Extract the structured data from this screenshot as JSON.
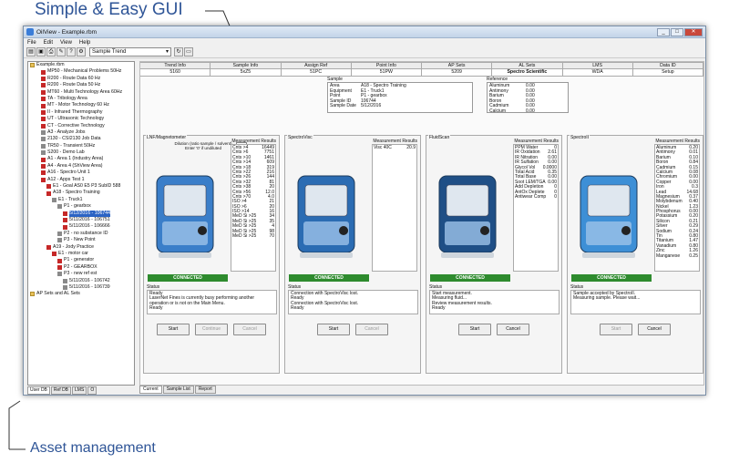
{
  "annotations": {
    "top": "Simple & Easy GUI",
    "bottom": "Asset management"
  },
  "window": {
    "title": "OilView - Example.rbm"
  },
  "menu": [
    "File",
    "Edit",
    "View",
    "Help"
  ],
  "toolbar": {
    "dropdown_value": "Sample Trend"
  },
  "tree": [
    {
      "label": "Example.rbm",
      "indent": 0,
      "mk": "folder"
    },
    {
      "label": "MP50 - Mechanical Problems  50Hz",
      "indent": 2,
      "mk": "red"
    },
    {
      "label": "R200 - Route Data  60 Hz",
      "indent": 2,
      "mk": "red"
    },
    {
      "label": "R200 - Route Data  50 Hz",
      "indent": 2,
      "mk": "red"
    },
    {
      "label": "MT60 - Multi Technology Area  60Hz",
      "indent": 2,
      "mk": "red"
    },
    {
      "label": "TA - Tribology Area",
      "indent": 2,
      "mk": "red"
    },
    {
      "label": "MT - Motor Technology 60 Hz",
      "indent": 2,
      "mk": "red"
    },
    {
      "label": "II - Infrared Thermography",
      "indent": 2,
      "mk": "red"
    },
    {
      "label": "UT - Ultrasonic Technology",
      "indent": 2,
      "mk": "red"
    },
    {
      "label": "CT - Corrective Technology",
      "indent": 2,
      "mk": "red"
    },
    {
      "label": "A3 - Analyze Jobs",
      "indent": 2,
      "mk": "gray"
    },
    {
      "label": "2130 - CSI2130 Job Data",
      "indent": 2,
      "mk": "gray"
    },
    {
      "label": "TR50 - Transient  50Hz",
      "indent": 2,
      "mk": "gray"
    },
    {
      "label": "S200 - Demo Lab",
      "indent": 2,
      "mk": "gray"
    },
    {
      "label": "A1 - Area 1 (Industry Area)",
      "indent": 2,
      "mk": "red"
    },
    {
      "label": "A4 - Area 4 (ShView Area)",
      "indent": 2,
      "mk": "red"
    },
    {
      "label": "A16 - Spectro Unit 1",
      "indent": 2,
      "mk": "red"
    },
    {
      "label": "A12 - Apps Test 1",
      "indent": 2,
      "mk": "red"
    },
    {
      "label": "E1 - Goal AS0 E5 P3 SubID 588",
      "indent": 3,
      "mk": "red"
    },
    {
      "label": "A18 - Spectro Training",
      "indent": 3,
      "mk": "red"
    },
    {
      "label": "E1 - Truck1",
      "indent": 4,
      "mk": "gray"
    },
    {
      "label": "P1 - gearbox",
      "indent": 5,
      "mk": "gray"
    },
    {
      "label": "5/12/2016 - 106744",
      "indent": 6,
      "mk": "red",
      "sel": true
    },
    {
      "label": "5/11/2016 - 106751",
      "indent": 6,
      "mk": "red"
    },
    {
      "label": "5/11/2016 - 106666",
      "indent": 6,
      "mk": "red"
    },
    {
      "label": "P2 - no substance ID",
      "indent": 5,
      "mk": "gray"
    },
    {
      "label": "P3 - New Point",
      "indent": 5,
      "mk": "gray"
    },
    {
      "label": "A19 - Jody Practice",
      "indent": 3,
      "mk": "red"
    },
    {
      "label": "E1 - motor car",
      "indent": 4,
      "mk": "red"
    },
    {
      "label": "P1 - generator",
      "indent": 5,
      "mk": "red"
    },
    {
      "label": "P2 - GEARBOX",
      "indent": 5,
      "mk": "red"
    },
    {
      "label": "P3 - new ref est",
      "indent": 5,
      "mk": "gray"
    },
    {
      "label": "5/11/2016 - 106742",
      "indent": 6,
      "mk": "gray"
    },
    {
      "label": "5/11/2016 - 106739",
      "indent": 6,
      "mk": "gray"
    },
    {
      "label": "AP Sets and AL Sets",
      "indent": 0,
      "mk": "folder"
    }
  ],
  "left_tabs": [
    "User DB",
    "Ref DB",
    "LMS",
    "O"
  ],
  "info_headers": [
    "Trend Info",
    "Sample Info",
    "Assign Ref",
    "Point Info",
    "AP Sets",
    "AL Sets",
    "LMS",
    "Data ID"
  ],
  "info_values": [
    "5160",
    "5xZ5",
    "51PC",
    "51PW",
    "5209",
    "Spectro Scientific",
    "WDA",
    "Setup"
  ],
  "sample": {
    "caption": "Sample",
    "fields": [
      {
        "k": "Area",
        "v": "A18 - Spectro Training"
      },
      {
        "k": "Equipment",
        "v": "E1 - Truck1"
      },
      {
        "k": "Point",
        "v": "P1 - gearbox"
      },
      {
        "k": "Sample ID",
        "v": "106744"
      },
      {
        "k": "Sample Date",
        "v": "5/12/2016"
      }
    ]
  },
  "reference": {
    "caption": "Reference",
    "fields": [
      {
        "k": "Aluminum",
        "v": "0.00"
      },
      {
        "k": "Antimony",
        "v": "0.00"
      },
      {
        "k": "Barium",
        "v": "0.00"
      },
      {
        "k": "Boron",
        "v": "0.00"
      },
      {
        "k": "Cadmium",
        "v": "0.00"
      },
      {
        "k": "Calcium",
        "v": "0.00"
      }
    ]
  },
  "panels": [
    {
      "title": "LNF/Magnetometer",
      "dilution": "Dilution (ratio sample / solvent) Enter '0' if undiluted",
      "mr_title": "Measurement Results",
      "results": [
        {
          "k": "Cnts >4",
          "v": "16449"
        },
        {
          "k": "Cnts >6",
          "v": "7751"
        },
        {
          "k": "Cnts >10",
          "v": "1461"
        },
        {
          "k": "Cnts >14",
          "v": "609"
        },
        {
          "k": "Cnts >18",
          "v": "319"
        },
        {
          "k": "Cnts >22",
          "v": "216"
        },
        {
          "k": "Cnts >26",
          "v": "144"
        },
        {
          "k": "Cnts >32",
          "v": "81"
        },
        {
          "k": "Cnts >38",
          "v": "20"
        },
        {
          "k": "Cnts >56",
          "v": "12.0"
        },
        {
          "k": "Cnts >70",
          "v": "4.0"
        },
        {
          "k": "ISO >4",
          "v": "21"
        },
        {
          "k": "ISO >6",
          "v": "20"
        },
        {
          "k": "ISO >14",
          "v": "16"
        },
        {
          "k": "MeD Si >25",
          "v": "34"
        },
        {
          "k": "MeD Si >25",
          "v": "35"
        },
        {
          "k": "MeD Si >25",
          "v": "4"
        },
        {
          "k": "MeD Si >25",
          "v": "98"
        },
        {
          "k": "MeD Si >25",
          "v": "70"
        }
      ],
      "connected": "CONNECTED",
      "status_cap": "Status",
      "status": [
        "Ready",
        "LaserNet Fines is currently busy performing another",
        "operation or is not on the Main Menu.",
        "Ready"
      ],
      "buttons": [
        {
          "label": "Start",
          "disabled": false
        },
        {
          "label": "Continue",
          "disabled": true
        },
        {
          "label": "Cancel",
          "disabled": true
        }
      ],
      "device_color": "#3a7ec9"
    },
    {
      "title": "SpectroVisc",
      "mr_title": "Measurement Results",
      "results": [
        {
          "k": "Visc 40C",
          "v": "20.9"
        }
      ],
      "connected": "CONNECTED",
      "status_cap": "Status",
      "status": [
        "Connection with SpectroVisc lost.",
        "Ready",
        "Connection with SpectroVisc lost.",
        "Ready"
      ],
      "buttons": [
        {
          "label": "Start",
          "disabled": false
        },
        {
          "label": "Cancel",
          "disabled": true
        }
      ],
      "device_color": "#2b6cb3"
    },
    {
      "title": "FluidScan",
      "mr_title": "Measurement Results",
      "results": [
        {
          "k": "PPM Water",
          "v": "0"
        },
        {
          "k": "IR Oxidation",
          "v": "2.61"
        },
        {
          "k": "IR Nitration",
          "v": "0.00"
        },
        {
          "k": "IR Sulfation",
          "v": "0.00"
        },
        {
          "k": "Glycol Vol",
          "v": "0.0000"
        },
        {
          "k": "Total Acid",
          "v": "0.35"
        },
        {
          "k": "Total Base",
          "v": "0.00"
        },
        {
          "k": "Soot LEM/TGA",
          "v": "0.00"
        },
        {
          "k": "Add Depletion",
          "v": "0"
        },
        {
          "k": "AntOx Deplete",
          "v": "0"
        },
        {
          "k": "Antiwear Comp",
          "v": "0"
        }
      ],
      "connected": "CONNECTED",
      "status_cap": "Status",
      "status": [
        "Start measurement.",
        "Measuring fluid...",
        "Review measurement results.",
        "Ready"
      ],
      "buttons": [
        {
          "label": "Start",
          "disabled": false
        },
        {
          "label": "Cancel",
          "disabled": false
        }
      ],
      "device_color": "#1f4f86"
    },
    {
      "title": "SpectroII",
      "mr_title": "Measurement Results",
      "results": [
        {
          "k": "Aluminum",
          "v": "0.20"
        },
        {
          "k": "Antimony",
          "v": "0.01"
        },
        {
          "k": "Barium",
          "v": "0.10"
        },
        {
          "k": "Boron",
          "v": "0.84"
        },
        {
          "k": "Cadmium",
          "v": "0.15"
        },
        {
          "k": "Calcium",
          "v": "0.08"
        },
        {
          "k": "Chromium",
          "v": "0.00"
        },
        {
          "k": "Copper",
          "v": "0.00"
        },
        {
          "k": "Iron",
          "v": "0.3"
        },
        {
          "k": "Lead",
          "v": "14.68"
        },
        {
          "k": "Magnesium",
          "v": "0.37"
        },
        {
          "k": "Molybdenum",
          "v": "0.40"
        },
        {
          "k": "Nickel",
          "v": "1.23"
        },
        {
          "k": "Phosphorus",
          "v": "0.00"
        },
        {
          "k": "Potassium",
          "v": "0.20"
        },
        {
          "k": "Silicon",
          "v": "0.21"
        },
        {
          "k": "Silver",
          "v": "0.29"
        },
        {
          "k": "Sodium",
          "v": "0.24"
        },
        {
          "k": "Tin",
          "v": "0.80"
        },
        {
          "k": "Titanium",
          "v": "1.47"
        },
        {
          "k": "Vanadium",
          "v": "0.80"
        },
        {
          "k": "Zinc",
          "v": "1.26"
        },
        {
          "k": "Manganese",
          "v": "0.25"
        }
      ],
      "connected": "CONNECTED",
      "status_cap": "Status",
      "status": [
        "Sample accepted by SpectroII.",
        "Measuring sample. Please wait..."
      ],
      "buttons": [
        {
          "label": "Start",
          "disabled": true
        },
        {
          "label": "Cancel",
          "disabled": false
        }
      ],
      "device_color": "#3d8fd6"
    }
  ],
  "bottom_tabs": [
    "Current",
    "Sample List",
    "Report"
  ]
}
